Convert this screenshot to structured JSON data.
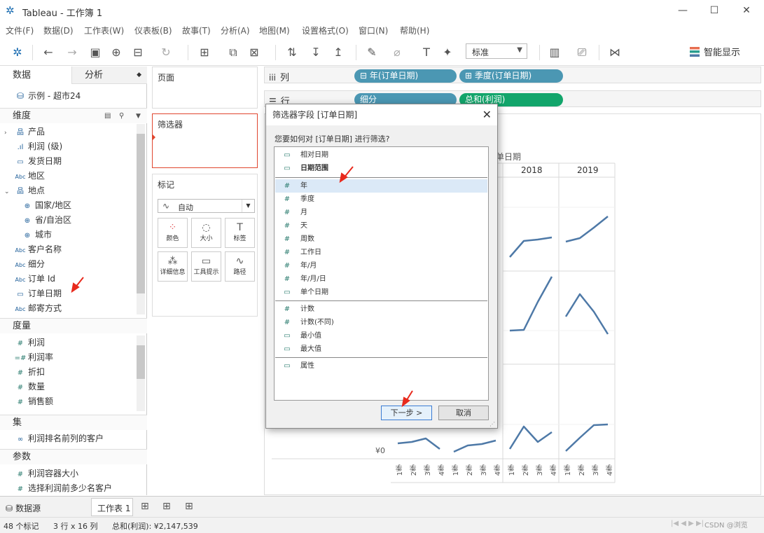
{
  "window": {
    "title": "Tableau - 工作簿 1"
  },
  "menu": [
    "文件(F)",
    "数据(D)",
    "工作表(W)",
    "仪表板(B)",
    "故事(T)",
    "分析(A)",
    "地图(M)",
    "设置格式(O)",
    "窗口(N)",
    "帮助(H)"
  ],
  "toolbar": {
    "fit_value": "标准",
    "smart_label": "智能显示"
  },
  "left_panel": {
    "tabs": [
      "数据",
      "分析"
    ],
    "datasource": "示例 - 超市24",
    "dimensions_header": "维度",
    "dimensions": [
      {
        "label": "产品",
        "icon": "hierarchy-icon"
      },
      {
        "label": "利润 (级)",
        "icon": "bin-icon"
      },
      {
        "label": "发货日期",
        "icon": "calendar-icon"
      },
      {
        "label": "地区",
        "icon": "abc-icon"
      },
      {
        "label": "地点",
        "icon": "hierarchy-icon"
      },
      {
        "label": "国家/地区",
        "icon": "globe-icon"
      },
      {
        "label": "省/自治区",
        "icon": "globe-icon"
      },
      {
        "label": "城市",
        "icon": "globe-icon"
      },
      {
        "label": "客户名称",
        "icon": "abc-icon"
      },
      {
        "label": "细分",
        "icon": "abc-icon"
      },
      {
        "label": "订单 Id",
        "icon": "abc-icon"
      },
      {
        "label": "订单日期",
        "icon": "calendar-icon"
      },
      {
        "label": "邮寄方式",
        "icon": "abc-icon"
      }
    ],
    "measures_header": "度量",
    "measures": [
      "利润",
      "利润率",
      "折扣",
      "数量",
      "销售额"
    ],
    "sets_header": "集",
    "sets": [
      "利润排名前列的客户"
    ],
    "params_header": "参数",
    "params": [
      "利润容器大小",
      "选择利润前多少名客户"
    ]
  },
  "cards": {
    "pages": "页面",
    "filters": "筛选器",
    "marks": "标记",
    "mark_type": "自动",
    "mark_buttons": [
      "颜色",
      "大小",
      "标签",
      "详细信息",
      "工具提示",
      "路径"
    ]
  },
  "shelves": {
    "columns_label": "列",
    "rows_label": "行",
    "columns_pills": [
      "年(订单日期)",
      "季度(订单日期)"
    ],
    "rows_pills": [
      "细分",
      "总和(利润)"
    ]
  },
  "view": {
    "col_header_partial": "单日期",
    "years": [
      "2018",
      "2019"
    ],
    "y_zero": "¥0",
    "quarters": [
      "1季",
      "2季",
      "3季",
      "4季"
    ]
  },
  "dialog": {
    "title": "筛选器字段 [订单日期]",
    "question": "您要如何对 [订单日期] 进行筛选?",
    "group1": [
      "相对日期",
      "日期范围"
    ],
    "group2": [
      "年",
      "季度",
      "月",
      "天",
      "周数",
      "工作日",
      "年/月",
      "年/月/日",
      "单个日期"
    ],
    "group3": [
      "计数",
      "计数(不同)",
      "最小值",
      "最大值"
    ],
    "group4": [
      "属性"
    ],
    "next": "下一步 >",
    "cancel": "取消"
  },
  "sheets": {
    "datasource_tab": "数据源",
    "sheet_tab": "工作表 1"
  },
  "status": {
    "marks": "48 个标记",
    "grid": "3 行 x 16 列",
    "sum": "总和(利润): ¥2,147,539",
    "watermark": "CSDN @浏览"
  },
  "colors": {
    "pill_blue": "#4b97b3",
    "pill_green": "#12a56b",
    "line": "#4e79a7",
    "arrow": "#e8291c"
  }
}
